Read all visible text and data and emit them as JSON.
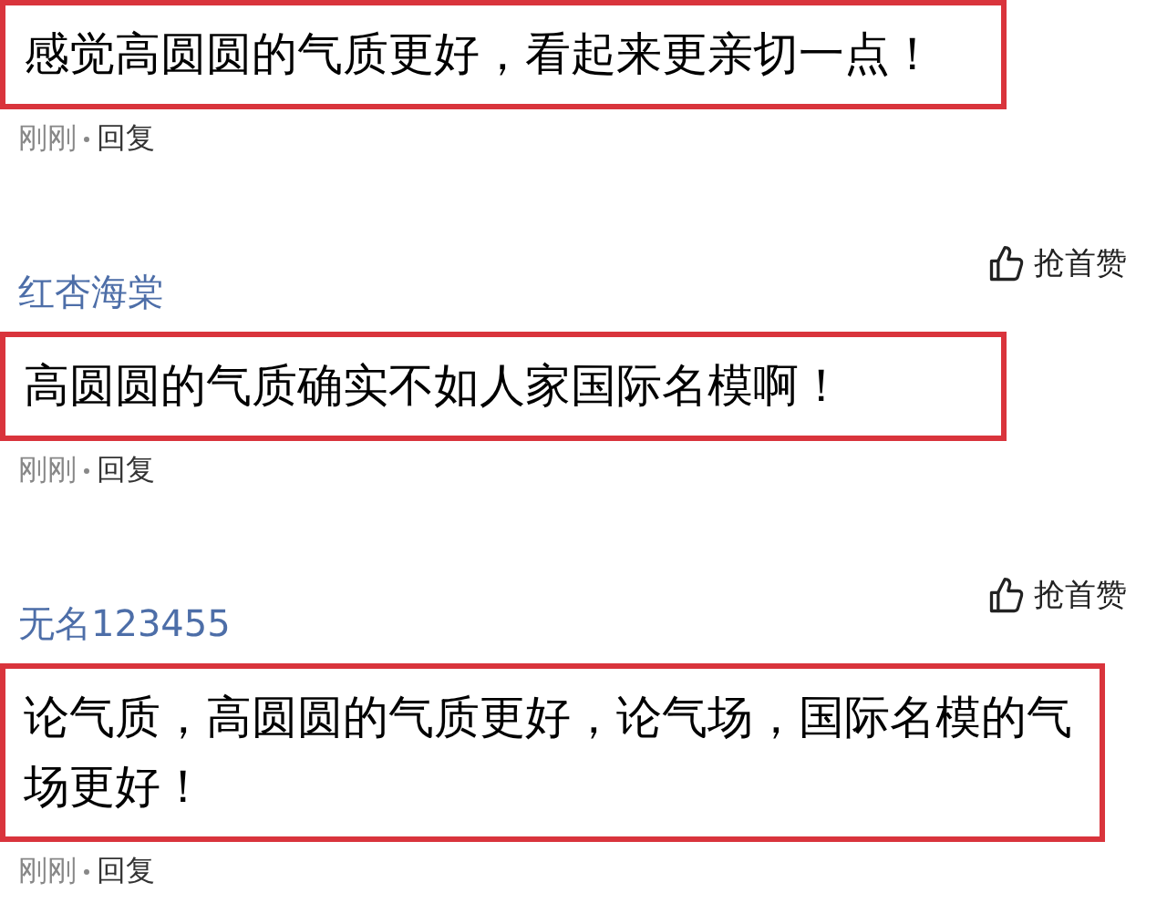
{
  "comments": [
    {
      "text": "感觉高圆圆的气质更好，看起来更亲切一点！",
      "highlighted": true,
      "time": "刚刚",
      "reply": "回复"
    },
    {
      "username": "红杏海棠",
      "like": "抢首赞",
      "text": "高圆圆的气质确实不如人家国际名模啊！",
      "highlighted": true,
      "time": "刚刚",
      "reply": "回复"
    },
    {
      "username": "无名123455",
      "like": "抢首赞",
      "text": "论气质，高圆圆的气质更好，论气场，国际名模的气场更好！",
      "highlighted": true,
      "time": "刚刚",
      "reply": "回复"
    }
  ]
}
